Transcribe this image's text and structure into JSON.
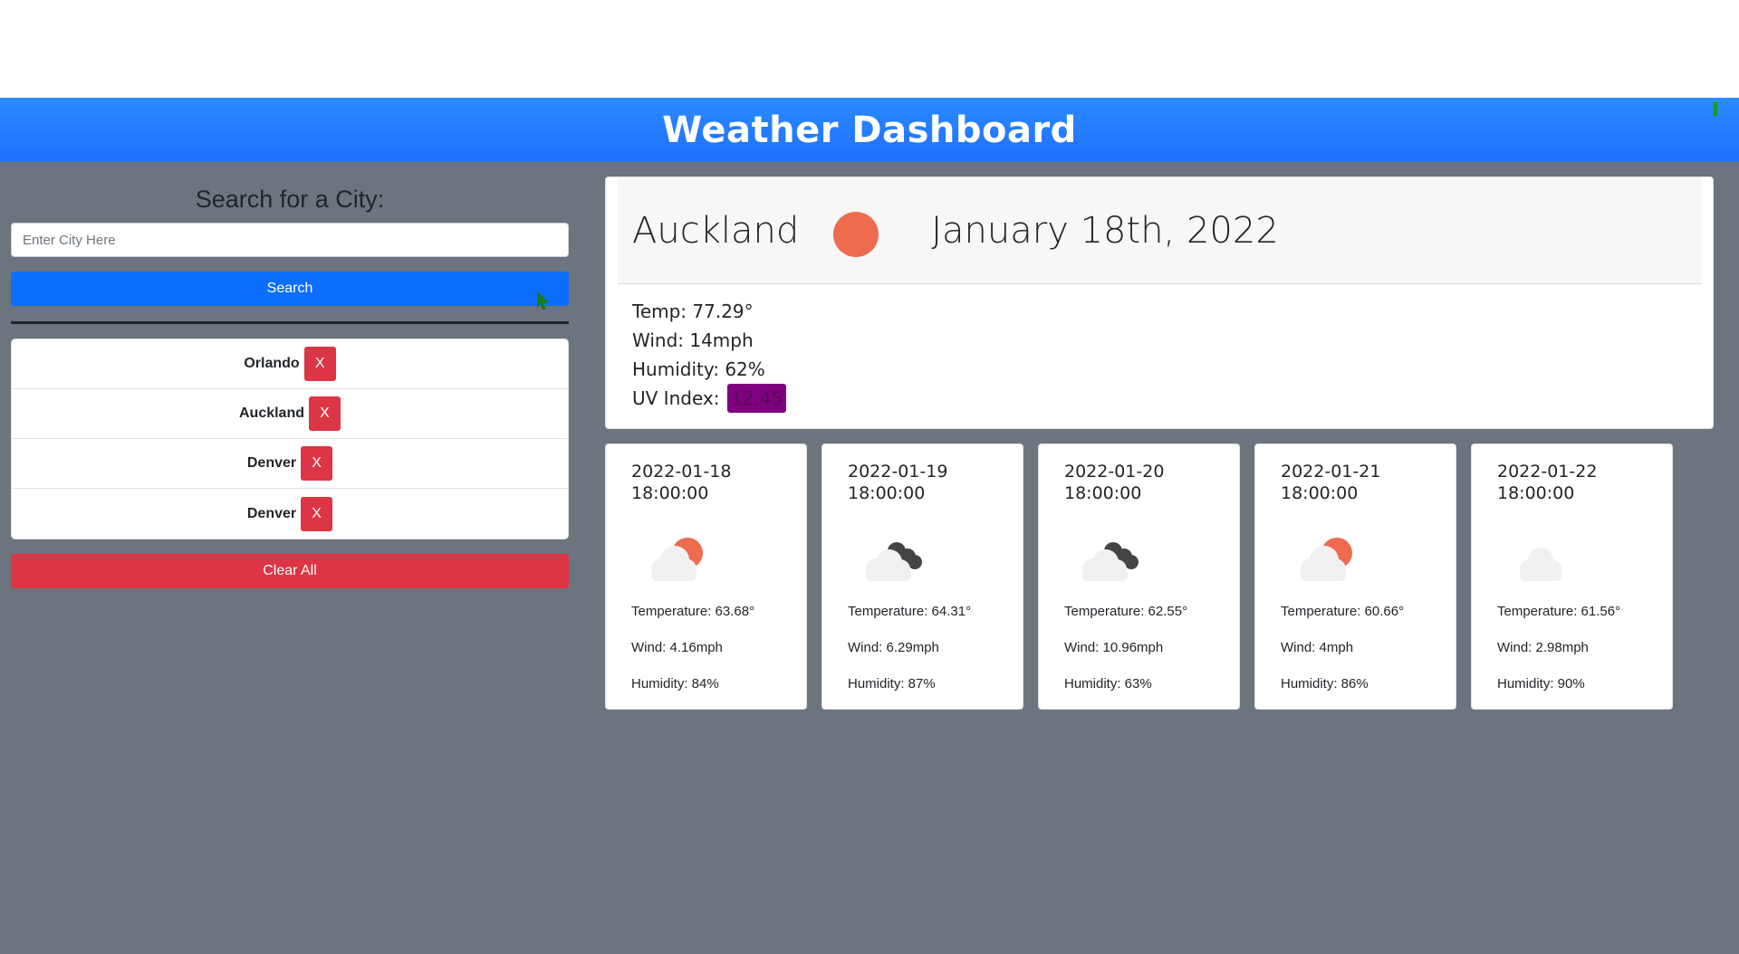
{
  "header": {
    "title": "Weather Dashboard"
  },
  "search": {
    "title": "Search for a City:",
    "placeholder": "Enter City Here",
    "button_label": "Search",
    "clear_label": "Clear All"
  },
  "history": [
    {
      "city": "Orlando",
      "remove": "X"
    },
    {
      "city": "Auckland",
      "remove": "X"
    },
    {
      "city": "Denver",
      "remove": "X"
    },
    {
      "city": "Denver",
      "remove": "X"
    }
  ],
  "current": {
    "city": "Auckland",
    "date": "January 18th, 2022",
    "icon": "sun-icon",
    "temp": "Temp: 77.29°",
    "wind": "Wind: 14mph",
    "humidity": "Humidity: 62%",
    "uv_label": "UV Index:",
    "uv_value": "12.45",
    "uv_color": "#800080"
  },
  "forecast": [
    {
      "date": "2022-01-18",
      "time": "18:00:00",
      "icon": "cloud-sun-icon",
      "temp": "Temperature: 63.68°",
      "wind": "Wind: 4.16mph",
      "humidity": "Humidity: 84%"
    },
    {
      "date": "2022-01-19",
      "time": "18:00:00",
      "icon": "dark-clouds-icon",
      "temp": "Temperature: 64.31°",
      "wind": "Wind: 6.29mph",
      "humidity": "Humidity: 87%"
    },
    {
      "date": "2022-01-20",
      "time": "18:00:00",
      "icon": "dark-clouds-icon",
      "temp": "Temperature: 62.55°",
      "wind": "Wind: 10.96mph",
      "humidity": "Humidity: 63%"
    },
    {
      "date": "2022-01-21",
      "time": "18:00:00",
      "icon": "cloud-sun-icon",
      "temp": "Temperature: 60.66°",
      "wind": "Wind: 4mph",
      "humidity": "Humidity: 86%"
    },
    {
      "date": "2022-01-22",
      "time": "18:00:00",
      "icon": "cloud-icon",
      "temp": "Temperature: 61.56°",
      "wind": "Wind: 2.98mph",
      "humidity": "Humidity: 90%"
    }
  ],
  "colors": {
    "header": "#1f6fff",
    "background": "#6c757d",
    "primary": "#0d6efd",
    "danger": "#dc3545",
    "sun": "#ee6b4d"
  }
}
